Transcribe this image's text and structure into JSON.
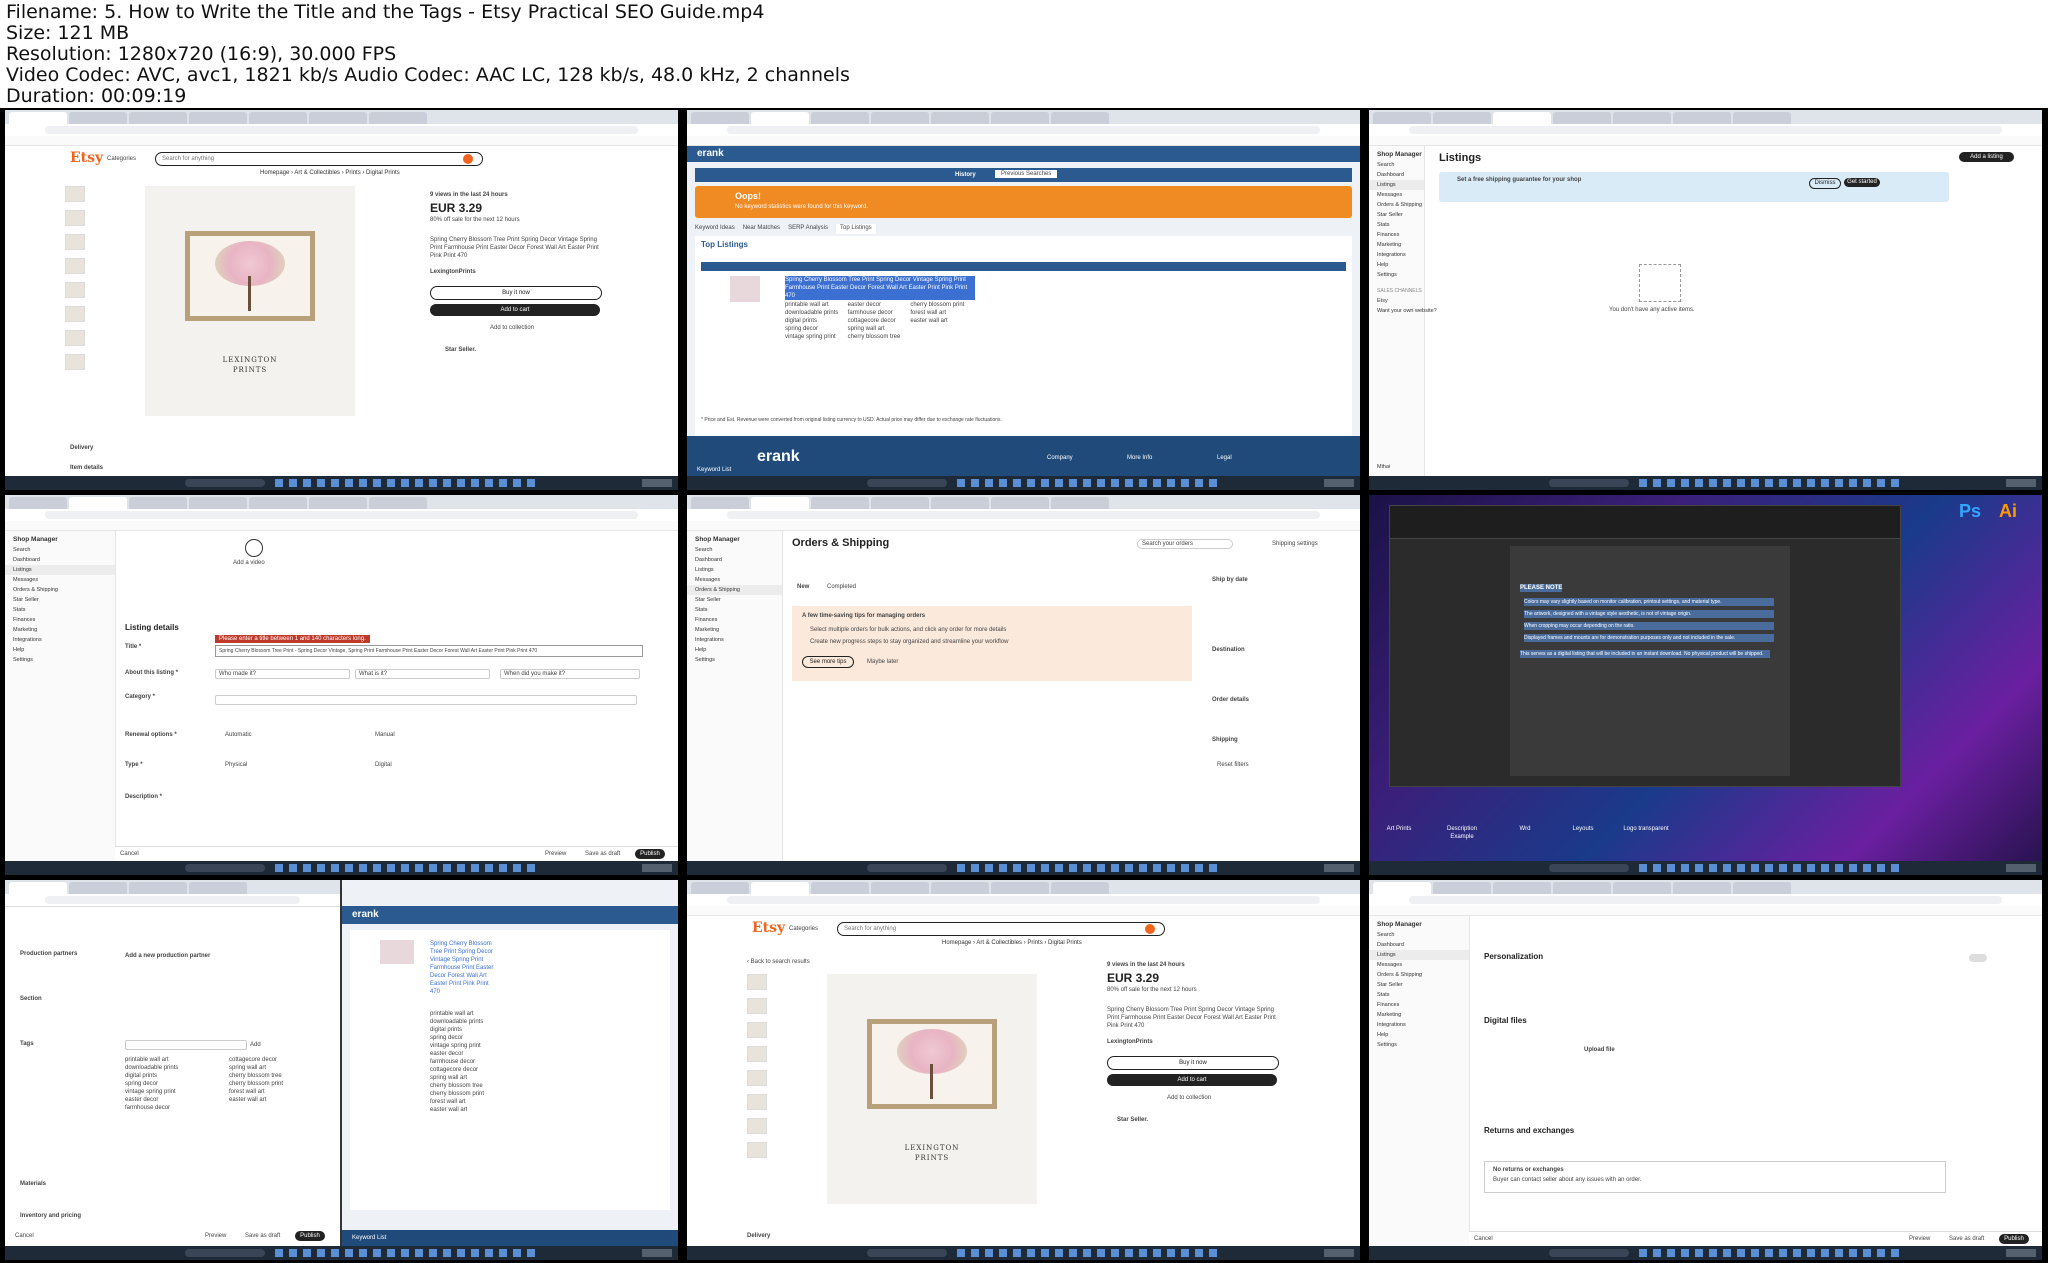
{
  "header": {
    "filename": "Filename: 5. How to Write the Title and the Tags - Etsy Practical SEO Guide.mp4",
    "size": "Size: 121 MB",
    "resolution": "Resolution: 1280x720 (16:9), 30.000 FPS",
    "codec": "Video Codec: AVC, avc1, 1821 kb/s Audio Codec: AAC LC, 128 kb/s, 48.0 kHz, 2 channels",
    "duration": "Duration: 00:09:19"
  },
  "etsy": {
    "logo": "Etsy",
    "categories": "Categories",
    "search_placeholder": "Search for anything",
    "breadcrumb": "Homepage › Art & Collectibles › Prints › Digital Prints",
    "views": "9 views in the last 24 hours",
    "price": "EUR 3.29",
    "sale": "80% off sale for the next 12 hours",
    "title": "Spring Cherry Blossom Tree Print Spring Decor Vintage Spring Print Farmhouse Print Easter Decor Forest Wall Art Easter Print Pink Print 470",
    "shop": "LexingtonPrints",
    "buy_now": "Buy it now",
    "add_to_cart": "Add to cart",
    "add_to_collection": "Add to collection",
    "star_seller": "Star Seller.",
    "delivery": "Delivery",
    "item_details": "Item details",
    "brand_line1": "LEXINGTON",
    "brand_line2": "PRINTS",
    "back": "‹ Back to search results"
  },
  "erank": {
    "logo": "erank",
    "oops": "Oops!",
    "oops_sub": "No keyword statistics were found for this keyword.",
    "top_listings": "Top Listings",
    "tabs": [
      "Keyword Ideas",
      "Near Matches",
      "SERP Analysis",
      "Top Listings"
    ],
    "history": "History",
    "previous": "Previous Searches",
    "footer_company": "Company",
    "footer_more": "More Info",
    "footer_legal": "Legal",
    "keyword_list": "Keyword List",
    "note": "* Price and Est. Revenue were converted from original listing currency to USD. Actual price may differ due to exchange rate fluctuations.",
    "tags": [
      "printable wall art",
      "downloadable prints",
      "digital prints",
      "spring decor",
      "vintage spring print",
      "easter decor",
      "farmhouse decor",
      "cottagecore decor",
      "spring wall art",
      "cherry blossom tree",
      "cherry blossom print",
      "forest wall art",
      "easter wall art"
    ]
  },
  "shop_manager": {
    "title": "Shop Manager",
    "items": [
      "Search",
      "Dashboard",
      "Listings",
      "Messages",
      "Orders & Shipping",
      "Star Seller",
      "Stats",
      "Finances",
      "Marketing",
      "Integrations",
      "Help",
      "Settings"
    ],
    "sales_channels": "SALES CHANNELS",
    "etsy": "Etsy",
    "want_website": "Want your own website?",
    "user": "Mihai"
  },
  "listings": {
    "title": "Listings",
    "add_listing": "Add a listing",
    "shipping_notice": "Set a free shipping guarantee for your shop",
    "dismiss": "Dismiss",
    "get_started": "Get started",
    "empty": "You don't have any active items."
  },
  "listing_details": {
    "heading": "Listing details",
    "title_label": "Title *",
    "error": "Please enter a title between 1 and 140 characters long.",
    "title_value": "Spring Cherry Blossom Tree Print - Spring Decor Vintage, Spring Print Farmhouse Print Easter Decor Forest Wall Art Easter Print Pink Print 470",
    "about": "About this listing *",
    "who_made": "Who made it?",
    "what_is": "What is it?",
    "when_made": "When did you make it?",
    "category": "Category *",
    "renewal": "Renewal options *",
    "automatic": "Automatic",
    "manual": "Manual",
    "type": "Type *",
    "physical": "Physical",
    "digital": "Digital",
    "description": "Description *",
    "cancel": "Cancel",
    "preview": "Preview",
    "save_draft": "Save as draft",
    "publish": "Publish",
    "add_video": "Add a video"
  },
  "orders": {
    "title": "Orders & Shipping",
    "search": "Search your orders",
    "shipping_settings": "Shipping settings",
    "new": "New",
    "completed": "Completed",
    "tip_title": "A few time-saving tips for managing orders",
    "tip1": "Select multiple orders for bulk actions, and click any order for more details",
    "tip2": "Create new progress steps to stay organized and streamline your workflow",
    "see_more": "See more tips",
    "maybe_later": "Maybe later",
    "ship_by_date": "Ship by date",
    "destination": "Destination",
    "order_details": "Order details",
    "shipping": "Shipping",
    "reset": "Reset filters"
  },
  "desktop": {
    "note_heading": "PLEASE NOTE",
    "note1": "Colors may vary slightly based on monitor calibration, printout settings, and material type.",
    "note2": "The artwork, designed with a vintage style aesthetic, is not of vintage origin.",
    "note3": "When cropping may occur depending on the ratio.",
    "note4": "Displayed frames and mounts are for demonstration purposes only and not included in the sale.",
    "note5": "This serves as a digital listing that will be included in an instant download. No physical product will be shipped.",
    "desktop_icons": [
      "Art Prints",
      "Description Example",
      "Wrd",
      "Leyouts",
      "Logo transparent"
    ],
    "app_ps": "Ps",
    "app_ai": "Ai"
  },
  "tags_panel": {
    "production_partners": "Production partners",
    "add_partner": "Add a new production partner",
    "section": "Section",
    "tags": "Tags",
    "add": "Add",
    "materials": "Materials",
    "inventory": "Inventory and pricing",
    "tags_list": [
      "printable wall art",
      "downloadable prints",
      "digital prints",
      "spring decor",
      "vintage spring print",
      "easter decor",
      "farmhouse decor",
      "cottagecore decor",
      "spring wall art",
      "cherry blossom tree",
      "cherry blossom print",
      "forest wall art",
      "easter wall art"
    ]
  },
  "settings_panel": {
    "personalization": "Personalization",
    "digital_files": "Digital files",
    "upload": "Upload file",
    "returns": "Returns and exchanges",
    "no_returns": "No returns or exchanges",
    "buyer_contact": "Buyer can contact seller about any issues with an order."
  }
}
